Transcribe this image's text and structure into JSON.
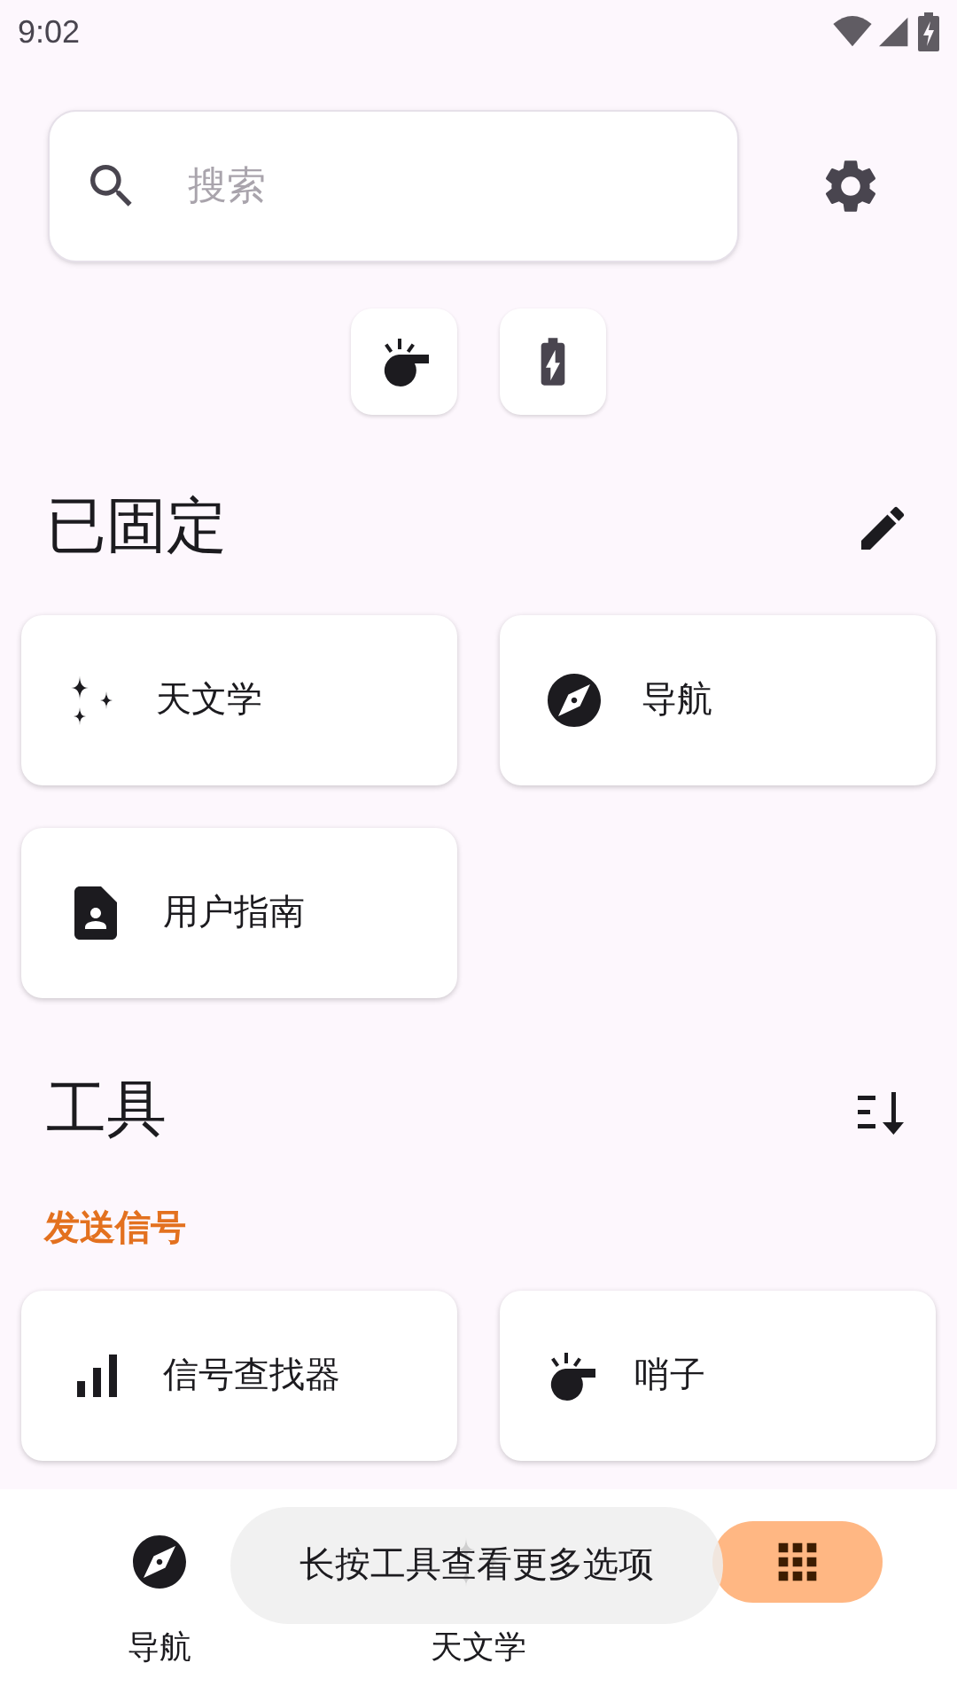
{
  "status_bar": {
    "time": "9:02"
  },
  "search": {
    "placeholder": "搜索"
  },
  "quick_actions": [
    {
      "kind": "whistle"
    },
    {
      "kind": "battery"
    }
  ],
  "pinned": {
    "title": "已固定",
    "items": [
      {
        "label": "天文学",
        "kind": "sparkles"
      },
      {
        "label": "导航",
        "kind": "compass"
      },
      {
        "label": "用户指南",
        "kind": "guide"
      }
    ]
  },
  "tools": {
    "title": "工具",
    "groups": [
      {
        "title": "发送信号",
        "items": [
          {
            "label": "信号查找器",
            "kind": "signal"
          },
          {
            "label": "哨子",
            "kind": "whistle"
          }
        ]
      }
    ]
  },
  "bottom_nav": [
    {
      "label": "导航",
      "kind": "compass",
      "selected": false
    },
    {
      "label": "天文学",
      "kind": "sparkles",
      "selected": false
    },
    {
      "kind": "grid",
      "selected": true
    }
  ],
  "toast": {
    "text": "长按工具查看更多选项"
  }
}
